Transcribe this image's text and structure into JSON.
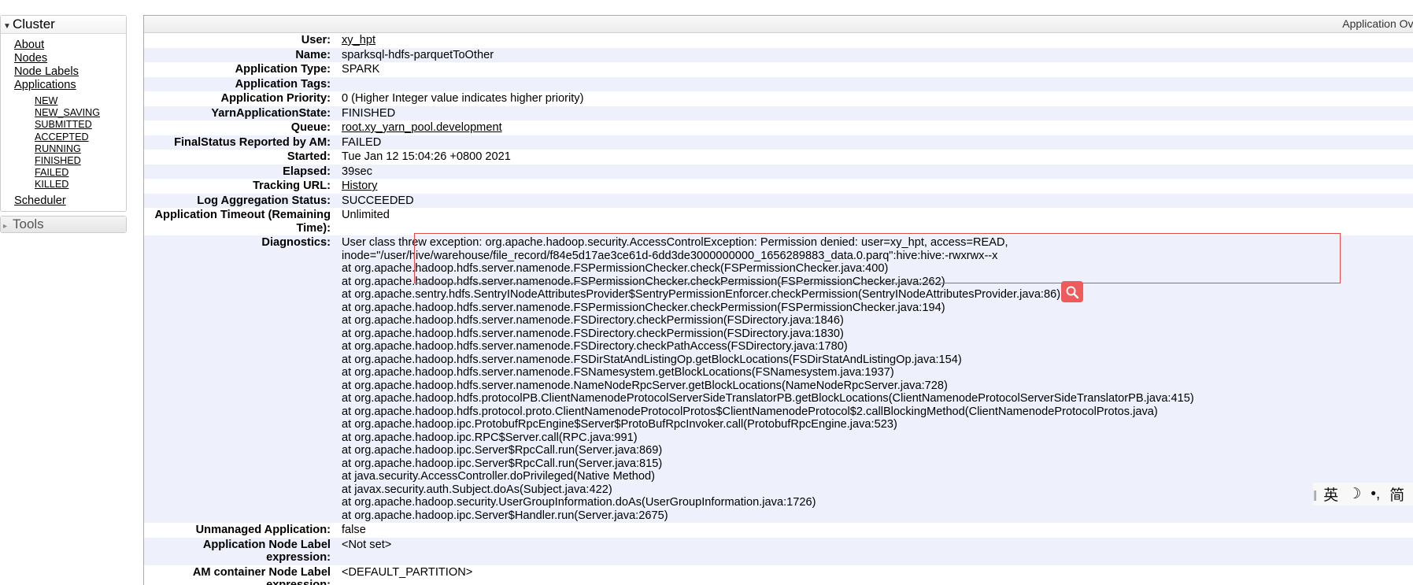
{
  "nav": {
    "cluster_label": "Cluster",
    "items": {
      "about": "About",
      "nodes": "Nodes",
      "node_labels": "Node Labels",
      "applications": "Applications",
      "scheduler": "Scheduler"
    },
    "app_states": [
      "NEW",
      "NEW_SAVING",
      "SUBMITTED",
      "ACCEPTED",
      "RUNNING",
      "FINISHED",
      "FAILED",
      "KILLED"
    ],
    "tools_label": "Tools"
  },
  "header": {
    "title_partial": "Application Overview"
  },
  "app": {
    "user_label": "User:",
    "user": "xy_hpt",
    "name_label": "Name:",
    "name": "sparksql-hdfs-parquetToOther",
    "type_label": "Application Type:",
    "type": "SPARK",
    "tags_label": "Application Tags:",
    "tags": "",
    "priority_label": "Application Priority:",
    "priority": "0 (Higher Integer value indicates higher priority)",
    "state_label": "YarnApplicationState:",
    "state": "FINISHED",
    "queue_label": "Queue:",
    "queue": "root.xy_yarn_pool.development",
    "final_status_label": "FinalStatus Reported by AM:",
    "final_status": "FAILED",
    "started_label": "Started:",
    "started": "Tue Jan 12 15:04:26 +0800 2021",
    "elapsed_label": "Elapsed:",
    "elapsed": "39sec",
    "tracking_label": "Tracking URL:",
    "tracking": "History",
    "log_agg_label": "Log Aggregation Status:",
    "log_agg": "SUCCEEDED",
    "timeout_label": "Application Timeout (Remaining Time):",
    "timeout": "Unlimited",
    "diagnostics_label": "Diagnostics:",
    "diagnostics": [
      "User class threw exception: org.apache.hadoop.security.AccessControlException: Permission denied: user=xy_hpt, access=READ, inode=\"/user/hive/warehouse/file_record/f84e5d17ae3ce61d-6dd3de3000000000_1656289883_data.0.parq\":hive:hive:-rwxrwx--x",
      "at org.apache.hadoop.hdfs.server.namenode.FSPermissionChecker.check(FSPermissionChecker.java:400)",
      "at org.apache.hadoop.hdfs.server.namenode.FSPermissionChecker.checkPermission(FSPermissionChecker.java:262)",
      "at org.apache.sentry.hdfs.SentryINodeAttributesProvider$SentryPermissionEnforcer.checkPermission(SentryINodeAttributesProvider.java:86)",
      "at org.apache.hadoop.hdfs.server.namenode.FSPermissionChecker.checkPermission(FSPermissionChecker.java:194)",
      "at org.apache.hadoop.hdfs.server.namenode.FSDirectory.checkPermission(FSDirectory.java:1846)",
      "at org.apache.hadoop.hdfs.server.namenode.FSDirectory.checkPermission(FSDirectory.java:1830)",
      "at org.apache.hadoop.hdfs.server.namenode.FSDirectory.checkPathAccess(FSDirectory.java:1780)",
      "at org.apache.hadoop.hdfs.server.namenode.FSDirStatAndListingOp.getBlockLocations(FSDirStatAndListingOp.java:154)",
      "at org.apache.hadoop.hdfs.server.namenode.FSNamesystem.getBlockLocations(FSNamesystem.java:1937)",
      "at org.apache.hadoop.hdfs.server.namenode.NameNodeRpcServer.getBlockLocations(NameNodeRpcServer.java:728)",
      "at org.apache.hadoop.hdfs.protocolPB.ClientNamenodeProtocolServerSideTranslatorPB.getBlockLocations(ClientNamenodeProtocolServerSideTranslatorPB.java:415)",
      "at org.apache.hadoop.hdfs.protocol.proto.ClientNamenodeProtocolProtos$ClientNamenodeProtocol$2.callBlockingMethod(ClientNamenodeProtocolProtos.java)",
      "at org.apache.hadoop.ipc.ProtobufRpcEngine$Server$ProtoBufRpcInvoker.call(ProtobufRpcEngine.java:523)",
      "at org.apache.hadoop.ipc.RPC$Server.call(RPC.java:991)",
      "at org.apache.hadoop.ipc.Server$RpcCall.run(Server.java:869)",
      "at org.apache.hadoop.ipc.Server$RpcCall.run(Server.java:815)",
      "at java.security.AccessController.doPrivileged(Native Method)",
      "at javax.security.auth.Subject.doAs(Subject.java:422)",
      "at org.apache.hadoop.security.UserGroupInformation.doAs(UserGroupInformation.java:1726)",
      "at org.apache.hadoop.ipc.Server$Handler.run(Server.java:2675)"
    ],
    "unmanaged_label": "Unmanaged Application:",
    "unmanaged": "false",
    "node_label_expr_label": "Application Node Label expression:",
    "node_label_expr": "<Not set>",
    "am_node_label_label": "AM container Node Label expression:",
    "am_node_label": "<DEFAULT_PARTITION>"
  },
  "ime": {
    "grip": "||",
    "lang": "英",
    "moon": "☽",
    "punct": "•,",
    "mode": "简"
  },
  "colors": {
    "row_alt": "#eef0fb",
    "highlight": "#e54a4a",
    "search_badge": "#ef5a5a"
  }
}
